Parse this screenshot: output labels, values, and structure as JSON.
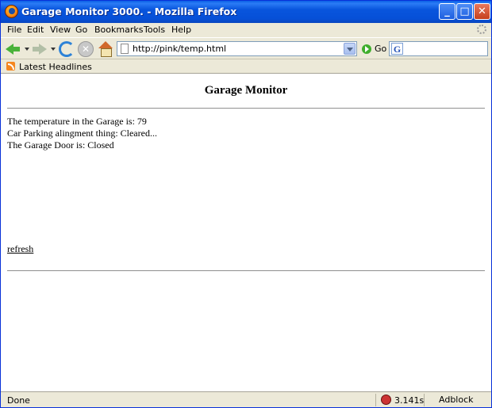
{
  "window": {
    "title": "Garage Monitor 3000. - Mozilla Firefox",
    "minimize_glyph": "_",
    "maximize_glyph": "□",
    "close_glyph": "✕"
  },
  "menu": {
    "items": [
      "File",
      "Edit",
      "View",
      "Go",
      "Bookmarks",
      "Tools",
      "Help"
    ]
  },
  "toolbar": {
    "url": "http://pink/temp.html",
    "go_label": "Go",
    "search_value": "",
    "stop_glyph": "✕",
    "search_engine_glyph": "G"
  },
  "bookmarks": {
    "items": [
      "Latest Headlines"
    ]
  },
  "page": {
    "title": "Garage Monitor",
    "lines": [
      "The temperature in the Garage is: 79",
      "Car Parking alingment thing: Cleared...",
      "The Garage Door is: Closed"
    ],
    "refresh_link": "refresh"
  },
  "status": {
    "text": "Done",
    "timer": "3.141s",
    "adblock": "Adblock"
  },
  "colors": {
    "titlebar": "#0855dd",
    "chrome": "#ece9d8",
    "content_bg": "#ffffff"
  },
  "icons": [
    "firefox-icon",
    "back-arrow-icon",
    "forward-arrow-icon",
    "reload-icon",
    "stop-icon",
    "home-icon",
    "page-icon",
    "go-icon",
    "google-search-icon",
    "rss-icon",
    "gear-icon",
    "extension-icon"
  ]
}
